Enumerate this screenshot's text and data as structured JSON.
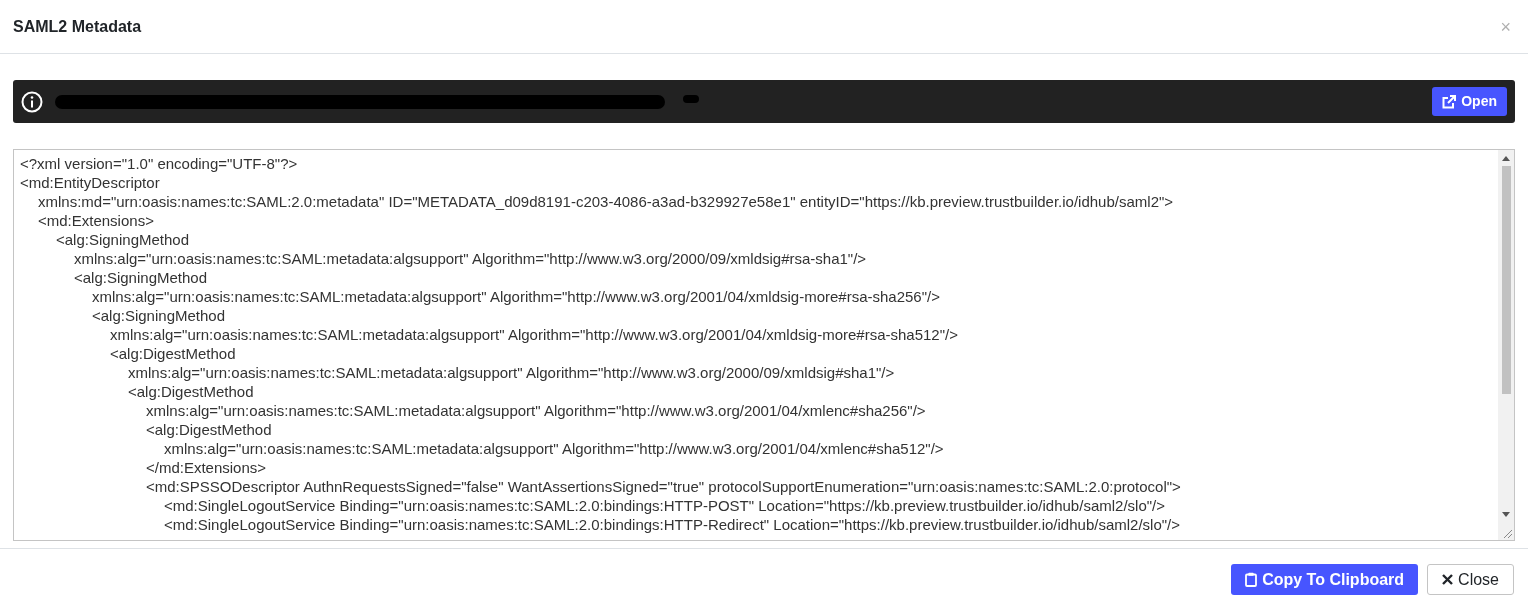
{
  "dialog": {
    "title": "SAML2 Metadata",
    "close_icon": "×"
  },
  "info_bar": {
    "button": "Open"
  },
  "metadata_lines": [
    {
      "text": "<?xml version=\"1.0\" encoding=\"UTF-8\"?>"
    },
    {
      "text": "<md:EntityDescriptor",
      "children": [
        {
          "text": "xmlns:md=\"urn:oasis:names:tc:SAML:2.0:metadata\" ID=\"METADATA_d09d8191-c203-4086-a3ad-b329927e58e1\" entityID=\"https://kb.preview.trustbuilder.io/idhub/saml2\">"
        },
        {
          "text": "<md:Extensions>",
          "children": [
            {
              "text": "<alg:SigningMethod",
              "children": [
                {
                  "text": "xmlns:alg=\"urn:oasis:names:tc:SAML:metadata:algsupport\" Algorithm=\"http://www.w3.org/2000/09/xmldsig#rsa-sha1\"/>"
                },
                {
                  "text": "<alg:SigningMethod",
                  "children": [
                    {
                      "text": "xmlns:alg=\"urn:oasis:names:tc:SAML:metadata:algsupport\" Algorithm=\"http://www.w3.org/2001/04/xmldsig-more#rsa-sha256\"/>"
                    },
                    {
                      "text": "<alg:SigningMethod",
                      "children": [
                        {
                          "text": "xmlns:alg=\"urn:oasis:names:tc:SAML:metadata:algsupport\" Algorithm=\"http://www.w3.org/2001/04/xmldsig-more#rsa-sha512\"/>"
                        },
                        {
                          "text": "<alg:DigestMethod",
                          "children": [
                            {
                              "text": "xmlns:alg=\"urn:oasis:names:tc:SAML:metadata:algsupport\" Algorithm=\"http://www.w3.org/2000/09/xmldsig#sha1\"/>"
                            },
                            {
                              "text": "<alg:DigestMethod",
                              "children": [
                                {
                                  "text": "xmlns:alg=\"urn:oasis:names:tc:SAML:metadata:algsupport\" Algorithm=\"http://www.w3.org/2001/04/xmlenc#sha256\"/>"
                                },
                                {
                                  "text": "<alg:DigestMethod",
                                  "children": [
                                    {
                                      "text": "xmlns:alg=\"urn:oasis:names:tc:SAML:metadata:algsupport\" Algorithm=\"http://www.w3.org/2001/04/xmlenc#sha512\"/>"
                                    }
                                  ]
                                },
                                {
                                  "text": "</md:Extensions>"
                                },
                                {
                                  "text": "<md:SPSSODescriptor AuthnRequestsSigned=\"false\" WantAssertionsSigned=\"true\" protocolSupportEnumeration=\"urn:oasis:names:tc:SAML:2.0:protocol\">",
                                  "children": [
                                    {
                                      "text": "<md:SingleLogoutService Binding=\"urn:oasis:names:tc:SAML:2.0:bindings:HTTP-POST\" Location=\"https://kb.preview.trustbuilder.io/idhub/saml2/slo\"/>"
                                    },
                                    {
                                      "text": "<md:SingleLogoutService Binding=\"urn:oasis:names:tc:SAML:2.0:bindings:HTTP-Redirect\" Location=\"https://kb.preview.trustbuilder.io/idhub/saml2/slo\"/>"
                                    }
                                  ]
                                }
                              ]
                            }
                          ]
                        }
                      ]
                    }
                  ]
                }
              ]
            }
          ]
        }
      ]
    }
  ],
  "footer_buttons": [
    {
      "kind": "primary",
      "label": "Copy To Clipboard"
    },
    {
      "kind": "close",
      "label": "Close"
    }
  ]
}
